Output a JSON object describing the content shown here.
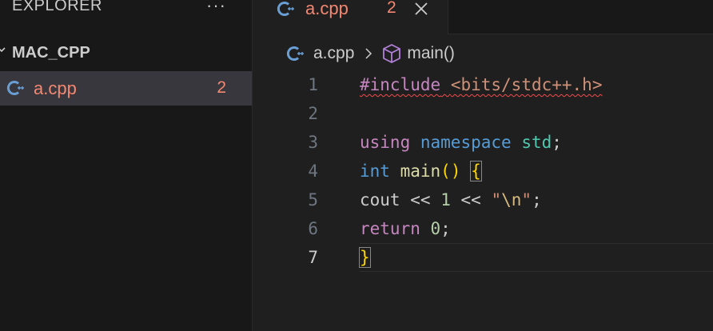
{
  "sidebar": {
    "title": "EXPLORER",
    "more_label": "···",
    "folder": {
      "label": "MAC_CPP"
    },
    "file": {
      "label": "a.cpp",
      "badge": "2"
    }
  },
  "tabs": [
    {
      "label": "a.cpp",
      "badge": "2",
      "close_label": "×"
    }
  ],
  "breadcrumb": {
    "file": "a.cpp",
    "symbol": "main()"
  },
  "editor": {
    "lines": [
      {
        "number": "1"
      },
      {
        "number": "2"
      },
      {
        "number": "3"
      },
      {
        "number": "4"
      },
      {
        "number": "5"
      },
      {
        "number": "6"
      },
      {
        "number": "7"
      }
    ],
    "tokens": {
      "include": "#include",
      "header": "<bits/stdc++.h>",
      "using": "using",
      "namespace": "namespace",
      "std": "std",
      "semi": ";",
      "int": "int",
      "main": "main",
      "parens": "()",
      "open_brace": "{",
      "cout": "cout",
      "shift": "<<",
      "one": "1",
      "newline_str_open": "\"",
      "newline_esc": "\\n",
      "newline_str_close": "\"",
      "return": "return",
      "zero": "0",
      "close_brace": "}"
    }
  },
  "colors": {
    "error": "#f48771",
    "keyword_control": "#c586c0",
    "keyword_storage": "#569cd6",
    "type": "#4ec9b0",
    "function": "#dcdcaa",
    "string": "#ce9178",
    "number": "#b5cea8",
    "bracket": "#ffd700",
    "sidebar_selected": "#37373d"
  },
  "icons": {
    "file_type": "cpp-icon",
    "symbol": "method-cube-icon",
    "chevron": "chevron-right-icon",
    "close": "close-icon"
  }
}
